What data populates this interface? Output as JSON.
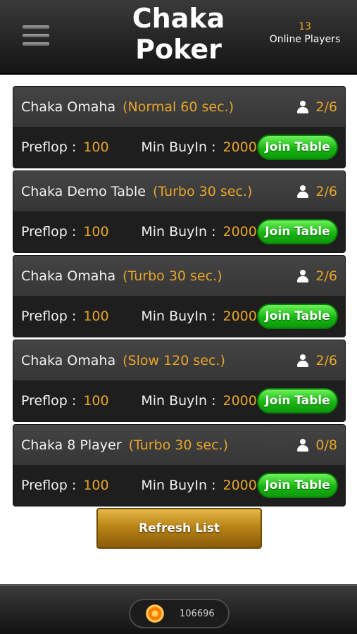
{
  "header": {
    "title_line1": "Chaka",
    "title_line2": "Poker",
    "online_count": "13",
    "online_label": "Online Players"
  },
  "labels": {
    "preflop": "Preflop :",
    "min_buyin": "Min BuyIn :",
    "join": "Join Table"
  },
  "tables": [
    {
      "name": "Chaka Omaha",
      "speed": "(Normal 60 sec.)",
      "players": "2/6",
      "preflop": "100",
      "min_buyin": "2000"
    },
    {
      "name": "Chaka Demo Table",
      "speed": "(Turbo 30 sec.)",
      "players": "2/6",
      "preflop": "100",
      "min_buyin": "2000"
    },
    {
      "name": "Chaka Omaha",
      "speed": "(Turbo 30 sec.)",
      "players": "2/6",
      "preflop": "100",
      "min_buyin": "2000"
    },
    {
      "name": "Chaka Omaha",
      "speed": "(Slow 120 sec.)",
      "players": "2/6",
      "preflop": "100",
      "min_buyin": "2000"
    },
    {
      "name": "Chaka 8 Player",
      "speed": "(Turbo 30 sec.)",
      "players": "0/8",
      "preflop": "100",
      "min_buyin": "2000"
    }
  ],
  "refresh_label": "Refresh List",
  "footer": {
    "chips": "106696",
    "chip_icon": "poker-chip-icon"
  },
  "colors": {
    "accent": "#e8a52a",
    "join_green": "#18b512",
    "refresh_gold": "#b98416"
  }
}
